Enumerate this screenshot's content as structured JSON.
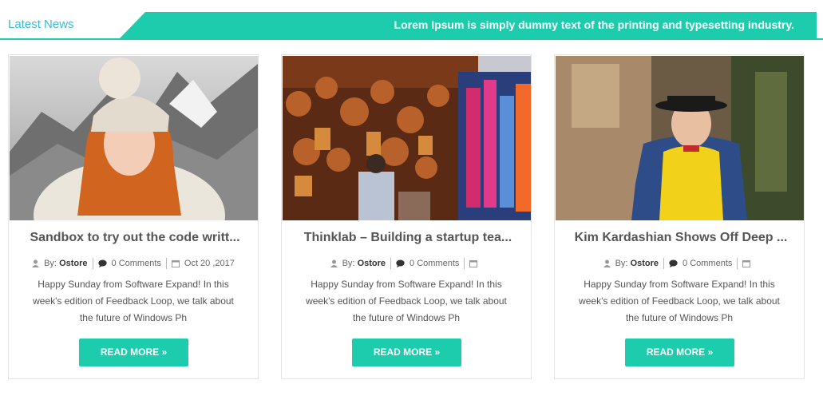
{
  "header": {
    "label": "Latest News",
    "ticker": "Lorem Ipsum is simply dummy text of the printing and typesetting industry.",
    "accent": "#1dccac",
    "label_color": "#3bb9d6"
  },
  "cards": [
    {
      "image": "girl-in-snow-hat-photo",
      "title": "Sandbox to try out the code writt...",
      "by_label": "By:",
      "author": "Ostore",
      "comments": "0 Comments",
      "date": "Oct 20 ,2017",
      "excerpt": "Happy Sunday from Software Expand! In this week's edition of Feedback Loop, we talk about the future of Windows Ph",
      "button": "READ MORE"
    },
    {
      "image": "market-bags-photo",
      "title": "Thinklab – Building a startup tea...",
      "by_label": "By:",
      "author": "Ostore",
      "comments": "0 Comments",
      "date": "",
      "excerpt": "Happy Sunday from Software Expand! In this week's edition of Feedback Loop, we talk about the future of Windows Ph",
      "button": "READ MORE"
    },
    {
      "image": "boy-with-hat-photo",
      "title": "Kim Kardashian Shows Off Deep ...",
      "by_label": "By:",
      "author": "Ostore",
      "comments": "0 Comments",
      "date": "",
      "excerpt": "Happy Sunday from Software Expand! In this week's edition of Feedback Loop, we talk about the future of Windows Ph",
      "button": "READ MORE"
    }
  ]
}
